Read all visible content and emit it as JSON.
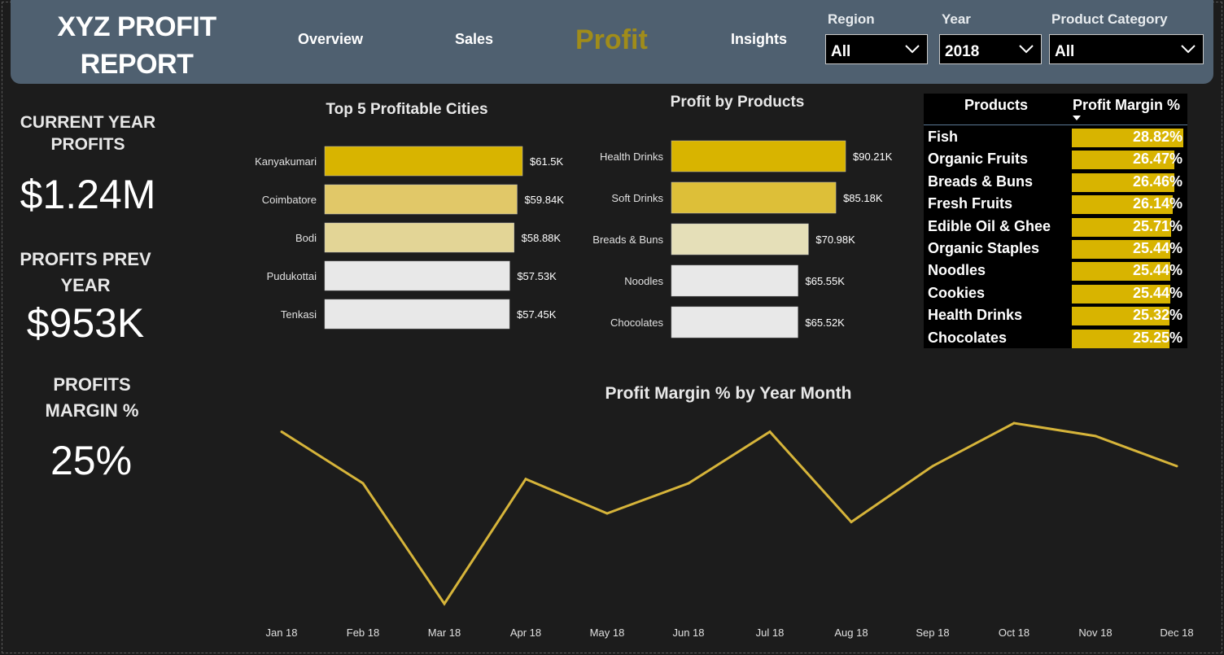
{
  "header": {
    "title_line1": "XYZ PROFIT",
    "title_line2": "REPORT",
    "nav": [
      "Overview",
      "Sales",
      "Profit",
      "Insights"
    ],
    "active_nav": "Profit",
    "filters": [
      {
        "label": "Region",
        "value": "All"
      },
      {
        "label": "Year",
        "value": "2018"
      },
      {
        "label": "Product Category",
        "value": "All"
      }
    ]
  },
  "kpis": {
    "current_label": "CURRENT YEAR PROFITS",
    "current_value": "$1.24M",
    "prev_label": "PROFITS PREV YEAR",
    "prev_value": "$953K",
    "margin_label": "PROFITS MARGIN %",
    "margin_value": "25%"
  },
  "colors": {
    "accent": "#d8b400",
    "line": "#d6b43a",
    "header_bg": "#4f6070",
    "active_nav": "#a08c1a",
    "bg": "#1c1c1c"
  },
  "chart_data": [
    {
      "type": "bar",
      "orientation": "horizontal",
      "title": "Top 5 Profitable Cities",
      "categories": [
        "Kanyakumari",
        "Coimbatore",
        "Bodi",
        "Pudukottai",
        "Tenkasi"
      ],
      "values": [
        61.5,
        59.84,
        58.88,
        57.53,
        57.45
      ],
      "labels": [
        "$61.5K",
        "$59.84K",
        "$58.88K",
        "$57.53K",
        "$57.45K"
      ],
      "bar_colors": [
        "#d8b400",
        "#e1c868",
        "#e3d596",
        "#e8e8e8",
        "#e8e8e8"
      ]
    },
    {
      "type": "bar",
      "orientation": "horizontal",
      "title": "Profit by Products",
      "categories": [
        "Health Drinks",
        "Soft Drinks",
        "Breads & Buns",
        "Noodles",
        "Chocolates"
      ],
      "values": [
        90.21,
        85.18,
        70.98,
        65.55,
        65.52
      ],
      "labels": [
        "$90.21K",
        "$85.18K",
        "$70.98K",
        "$65.55K",
        "$65.52K"
      ],
      "bar_colors": [
        "#d8b400",
        "#ddbf38",
        "#e5dfb8",
        "#e8e8e8",
        "#e8e8e8"
      ]
    },
    {
      "type": "table",
      "columns": [
        "Products",
        "Profit Margin %"
      ],
      "rows": [
        {
          "product": "Fish",
          "margin": 28.82,
          "label": "28.82%"
        },
        {
          "product": "Organic Fruits",
          "margin": 26.47,
          "label": "26.47%"
        },
        {
          "product": "Breads & Buns",
          "margin": 26.46,
          "label": "26.46%"
        },
        {
          "product": "Fresh Fruits",
          "margin": 26.14,
          "label": "26.14%"
        },
        {
          "product": "Edible Oil & Ghee",
          "margin": 25.71,
          "label": "25.71%"
        },
        {
          "product": "Organic Staples",
          "margin": 25.44,
          "label": "25.44%"
        },
        {
          "product": "Noodles",
          "margin": 25.44,
          "label": "25.44%"
        },
        {
          "product": "Cookies",
          "margin": 25.44,
          "label": "25.44%"
        },
        {
          "product": "Health Drinks",
          "margin": 25.32,
          "label": "25.32%"
        },
        {
          "product": "Chocolates",
          "margin": 25.25,
          "label": "25.25%"
        }
      ]
    },
    {
      "type": "line",
      "title": "Profit Margin % by Year Month",
      "x": [
        "Jan 18",
        "Feb 18",
        "Mar 18",
        "Apr 18",
        "May 18",
        "Jun 18",
        "Jul 18",
        "Aug 18",
        "Sep 18",
        "Oct 18",
        "Nov 18",
        "Dec 18"
      ],
      "values": [
        25.5,
        24.9,
        23.5,
        24.95,
        24.55,
        24.9,
        25.5,
        24.45,
        25.1,
        25.6,
        25.45,
        25.1
      ],
      "ylim": [
        23.5,
        25.6
      ],
      "grid": false
    }
  ]
}
